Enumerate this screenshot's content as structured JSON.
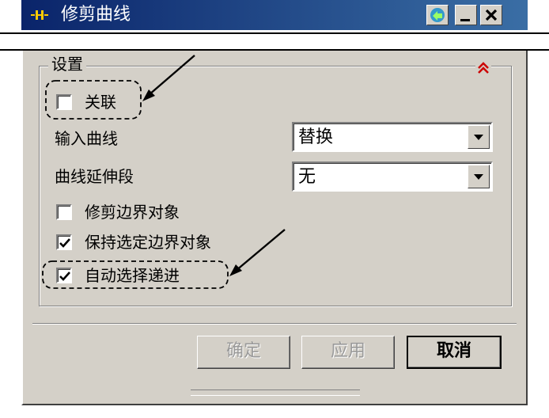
{
  "window": {
    "title": "修剪曲线",
    "app_icon": "dialog-icon",
    "help_icon": "help-arrow-icon",
    "minimize_icon": "minimize-icon",
    "close_icon": "close-icon"
  },
  "settings": {
    "group_label": "设置",
    "collapse_icon": "double-chevron-up-icon",
    "associative": {
      "label": "关联",
      "checked": false
    },
    "input_curve": {
      "label": "输入曲线",
      "value": "替换"
    },
    "curve_extension": {
      "label": "曲线延伸段",
      "value": "无"
    },
    "trim_bounding": {
      "label": "修剪边界对象",
      "checked": false
    },
    "keep_bounding": {
      "label": "保持选定边界对象",
      "checked": true
    },
    "auto_progress": {
      "label": "自动选择递进",
      "checked": true
    }
  },
  "buttons": {
    "ok": "确定",
    "apply": "应用",
    "cancel": "取消"
  },
  "colors": {
    "title_bar": "#0a246a",
    "dialog_bg": "#d4d0c8",
    "collapse_icon": "#cc0000"
  }
}
